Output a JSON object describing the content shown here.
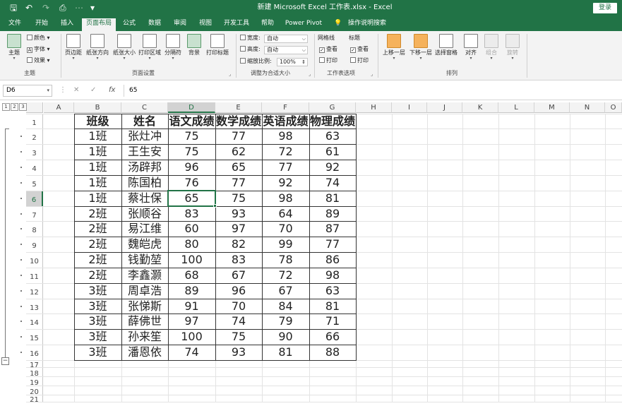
{
  "titlebar": {
    "title": "新建 Microsoft Excel 工作表.xlsx  -  Excel",
    "login": "登录",
    "save": "🖫",
    "undo": "↶",
    "redo": "↷",
    "preview": "⎙",
    "customize": "▾"
  },
  "tabs": [
    {
      "label": "文件"
    },
    {
      "label": "开始"
    },
    {
      "label": "插入"
    },
    {
      "label": "页面布局"
    },
    {
      "label": "公式"
    },
    {
      "label": "数据"
    },
    {
      "label": "审阅"
    },
    {
      "label": "视图"
    },
    {
      "label": "开发工具"
    },
    {
      "label": "帮助"
    },
    {
      "label": "Power Pivot"
    },
    {
      "label": "操作说明搜索"
    }
  ],
  "ribbon": {
    "theme": {
      "button": "主题",
      "colors": "颜色",
      "fonts": "字体",
      "effects": "效果",
      "group": "主题"
    },
    "page_setup": {
      "margins": "页边距",
      "orientation": "纸张方向",
      "size": "纸张大小",
      "print_area": "打印区域",
      "breaks": "分隔符",
      "background": "背景",
      "print_titles": "打印标题",
      "group": "页面设置"
    },
    "scale": {
      "width_label": "宽度:",
      "width_value": "自动",
      "height_label": "高度:",
      "height_value": "自动",
      "scale_label": "缩放比例:",
      "scale_value": "100%",
      "group": "调整为合适大小"
    },
    "sheet_options": {
      "gridlines": "网格线",
      "headings": "标题",
      "view1": "查看",
      "view2": "查看",
      "print1": "打印",
      "print2": "打印",
      "group": "工作表选项"
    },
    "arrange": {
      "bring_forward": "上移一层",
      "send_backward": "下移一层",
      "selection_pane": "选择窗格",
      "align": "对齐",
      "group_btn": "组合",
      "rotate": "旋转",
      "group": "排列"
    }
  },
  "formula_bar": {
    "name_box": "D6",
    "formula": "65",
    "fx": "fx",
    "cancel": "✕",
    "enter": "✓"
  },
  "outline_levels": [
    "1",
    "2",
    "3"
  ],
  "columns": [
    "A",
    "B",
    "C",
    "D",
    "E",
    "F",
    "G",
    "H",
    "I",
    "J",
    "K",
    "L",
    "M",
    "N",
    "O"
  ],
  "rows": [
    "1",
    "2",
    "3",
    "4",
    "5",
    "6",
    "7",
    "8",
    "9",
    "10",
    "11",
    "12",
    "13",
    "14",
    "15",
    "16",
    "17",
    "18",
    "19",
    "20",
    "21"
  ],
  "table": {
    "headers": [
      "班级",
      "姓名",
      "语文成绩",
      "数学成绩",
      "英语成绩",
      "物理成绩"
    ],
    "rows": [
      [
        "1班",
        "张灶冲",
        "75",
        "77",
        "98",
        "63"
      ],
      [
        "1班",
        "王生安",
        "75",
        "62",
        "72",
        "61"
      ],
      [
        "1班",
        "汤辟邦",
        "96",
        "65",
        "77",
        "92"
      ],
      [
        "1班",
        "陈国柏",
        "76",
        "77",
        "92",
        "74"
      ],
      [
        "1班",
        "蔡壮保",
        "65",
        "75",
        "98",
        "81"
      ],
      [
        "2班",
        "张顺谷",
        "83",
        "93",
        "64",
        "89"
      ],
      [
        "2班",
        "易江维",
        "60",
        "97",
        "70",
        "87"
      ],
      [
        "2班",
        "魏皑虎",
        "80",
        "82",
        "99",
        "77"
      ],
      [
        "2班",
        "钱勤堃",
        "100",
        "83",
        "78",
        "86"
      ],
      [
        "2班",
        "李鑫灏",
        "68",
        "67",
        "72",
        "98"
      ],
      [
        "3班",
        "周卓浩",
        "89",
        "96",
        "67",
        "63"
      ],
      [
        "3班",
        "张悌斯",
        "91",
        "70",
        "84",
        "81"
      ],
      [
        "3班",
        "薛佛世",
        "97",
        "74",
        "79",
        "71"
      ],
      [
        "3班",
        "孙来笙",
        "100",
        "75",
        "90",
        "66"
      ],
      [
        "3班",
        "潘恩依",
        "74",
        "93",
        "81",
        "88"
      ]
    ]
  },
  "selection": {
    "cell": "D6"
  },
  "colors": {
    "accent": "#217346",
    "ribbon_bg": "#f3f3f3"
  }
}
